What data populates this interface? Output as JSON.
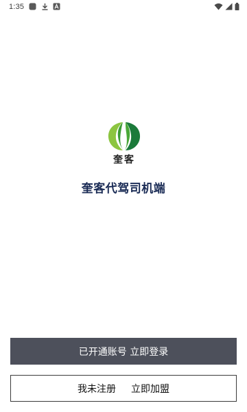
{
  "status_bar": {
    "time": "1:35",
    "icons": [
      "app-square-icon",
      "download-icon",
      "a-icon",
      "wifi-icon",
      "signal-icon",
      "battery-icon"
    ]
  },
  "logo": {
    "text": "奎客",
    "colors": {
      "leaf_left": "#3c9b34",
      "leaf_right": "#1b7a3a",
      "leaf_light": "#8cc540"
    }
  },
  "app_title": "奎客代驾司机端",
  "buttons": {
    "login_label": "已开通账号 立即登录",
    "join_label_left": "我未注册",
    "join_label_right": "立即加盟"
  },
  "colors": {
    "title": "#1a2b55",
    "login_bg": "#4d505b",
    "join_border": "#3a3a3a"
  }
}
